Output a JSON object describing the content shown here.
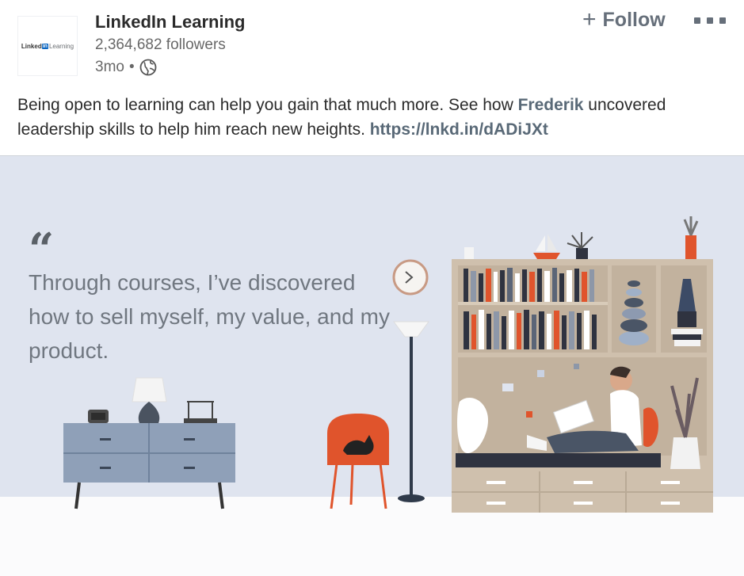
{
  "post": {
    "org_name": "LinkedIn Learning",
    "logo": {
      "brand": "Linked",
      "in": "in",
      "product": "Learning"
    },
    "followers": "2,364,682 followers",
    "time": "3mo",
    "separator": "•",
    "visibility_icon": "globe-icon",
    "follow_label": "Follow",
    "follow_icon": "plus-icon",
    "more_icon": "more-options-icon",
    "text_before": "Being open to learning can help you gain that much more. See how ",
    "mention": "Frederik",
    "text_after": " uncovered leadership skills to help him reach new heights. ",
    "link": "https://lnkd.in/dADiJXt"
  },
  "illustration": {
    "quote_mark": "“",
    "quote": "Through courses, I’ve discovered how to sell myself, my value, and my product."
  },
  "colors": {
    "wall": "#dfe4ef",
    "floor": "#fbfbfc",
    "accent_orange": "#d9532c",
    "link": "#596977"
  }
}
